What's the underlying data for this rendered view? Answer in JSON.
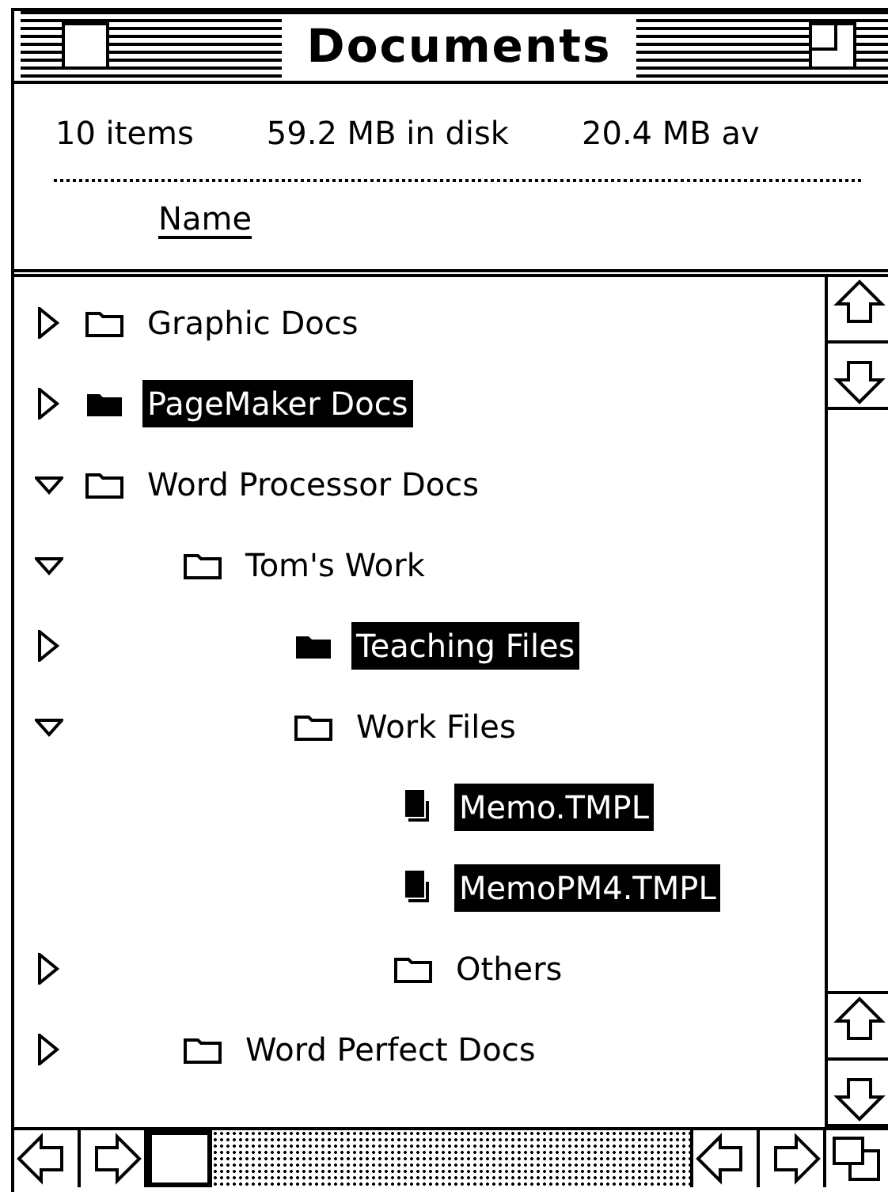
{
  "window": {
    "title": "Documents"
  },
  "info": [
    "10 items",
    "59.2 MB in disk",
    "20.4 MB av"
  ],
  "column": {
    "label": "Name"
  },
  "tree": [
    {
      "kind": "folder",
      "name": "Graphic Docs",
      "expanded": false,
      "selected": false
    },
    {
      "kind": "folder",
      "name": "PageMaker Docs",
      "expanded": false,
      "selected": true
    },
    {
      "kind": "folder",
      "name": "Word Processor Docs",
      "expanded": true,
      "selected": false,
      "children": [
        {
          "kind": "folder",
          "name": "Tom's Work",
          "expanded": true,
          "selected": false,
          "children": [
            {
              "kind": "folder",
              "name": "Teaching Files",
              "expanded": false,
              "selected": true
            },
            {
              "kind": "folder",
              "name": "Work Files",
              "expanded": true,
              "selected": false,
              "children": [
                {
                  "kind": "document",
                  "name": "Memo.TMPL",
                  "selected": true
                },
                {
                  "kind": "document",
                  "name": "MemoPM4.TMPL",
                  "selected": true
                },
                {
                  "kind": "folder",
                  "name": "Others",
                  "expanded": false,
                  "selected": false
                }
              ]
            }
          ]
        },
        {
          "kind": "folder",
          "name": "Word Perfect Docs",
          "expanded": false,
          "selected": false
        }
      ]
    }
  ]
}
